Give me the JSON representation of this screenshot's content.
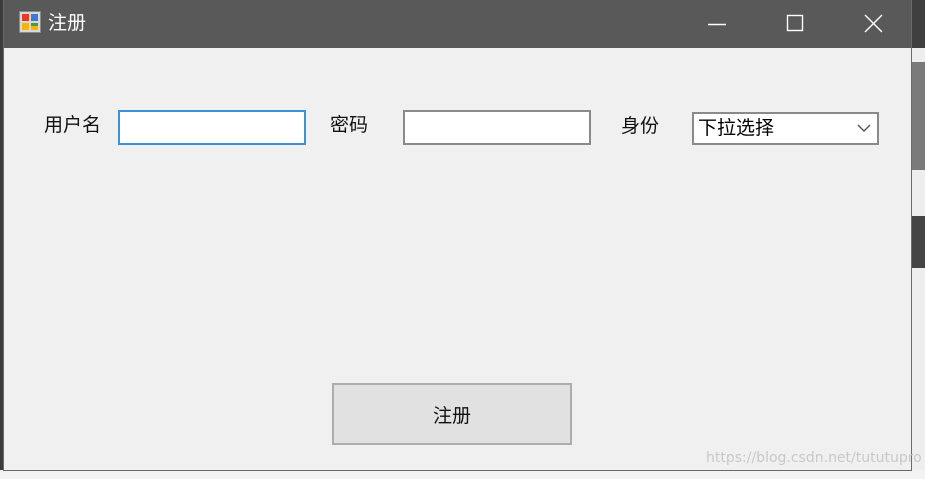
{
  "window": {
    "title": "注册"
  },
  "form": {
    "username_label": "用户名",
    "username_value": "",
    "password_label": "密码",
    "password_value": "",
    "role_label": "身份",
    "role_selected": "下拉选择"
  },
  "actions": {
    "register_label": "注册"
  },
  "watermark": "https://blog.csdn.net/tututupro",
  "colors": {
    "titlebar": "#595959",
    "window_bg": "#f0f0f0",
    "focus_border": "#3d8fd6",
    "button_bg": "#e1e1e1"
  },
  "icons": {
    "app": "winforms-app-icon",
    "minimize": "minimize-icon",
    "maximize": "maximize-icon",
    "close": "close-icon",
    "dropdown": "chevron-down-icon"
  }
}
